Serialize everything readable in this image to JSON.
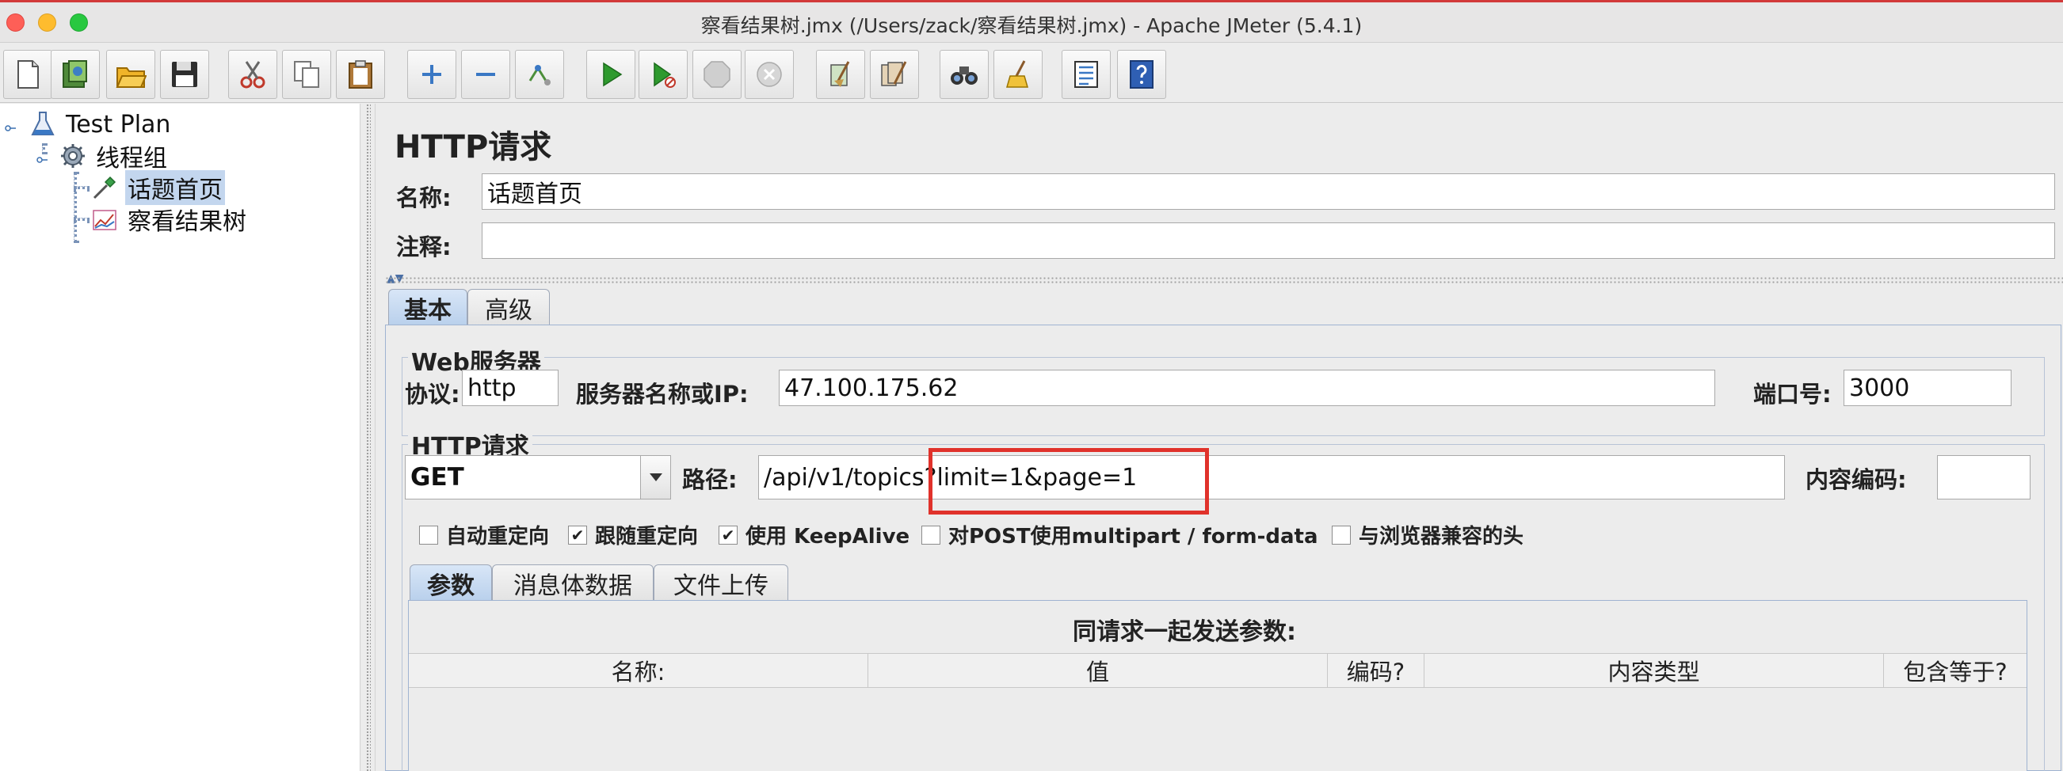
{
  "window": {
    "title": "察看结果树.jmx (/Users/zack/察看结果树.jmx) - Apache JMeter (5.4.1)"
  },
  "toolbar": {
    "buttons": [
      "new-icon",
      "templates-icon",
      "open-icon",
      "save-icon",
      "cut-icon",
      "copy-icon",
      "paste-icon",
      "expand-icon",
      "collapse-icon",
      "toggle-icon",
      "start-icon",
      "start-no-pause-icon",
      "stop-icon",
      "shutdown-icon",
      "clear-icon",
      "clear-all-icon",
      "search-icon",
      "reset-search-icon",
      "function-helper-icon",
      "help-icon"
    ]
  },
  "tree": {
    "items": [
      {
        "label": "Test Plan",
        "icon": "flask-icon"
      },
      {
        "label": "线程组",
        "icon": "gear-icon"
      },
      {
        "label": "话题首页",
        "icon": "pipette-icon",
        "selected": true
      },
      {
        "label": "察看结果树",
        "icon": "chart-icon"
      }
    ]
  },
  "panel": {
    "title": "HTTP请求",
    "name_label": "名称:",
    "name_value": "话题首页",
    "comment_label": "注释:",
    "comment_value": "",
    "tabs": [
      "基本",
      "高级"
    ],
    "web_server": {
      "group_title": "Web服务器",
      "protocol_label": "协议:",
      "protocol_value": "http",
      "server_label": "服务器名称或IP:",
      "server_value": "47.100.175.62",
      "port_label": "端口号:",
      "port_value": "3000"
    },
    "http_request": {
      "group_title": "HTTP请求",
      "method": "GET",
      "path_label": "路径:",
      "path_value": "/api/v1/topics?limit=1&page=1",
      "encoding_label": "内容编码:",
      "encoding_value": ""
    },
    "checkboxes": [
      {
        "label": "自动重定向",
        "checked": false
      },
      {
        "label": "跟随重定向",
        "checked": true
      },
      {
        "label": "使用 KeepAlive",
        "checked": true
      },
      {
        "label": "对POST使用multipart / form-data",
        "checked": false
      },
      {
        "label": "与浏览器兼容的头",
        "checked": false
      }
    ],
    "sub_tabs": [
      "参数",
      "消息体数据",
      "文件上传"
    ],
    "params_title": "同请求一起发送参数:",
    "table_headers": [
      "名称:",
      "值",
      "编码?",
      "内容类型",
      "包含等于?"
    ]
  },
  "colors": {
    "highlight": "#e0322b",
    "selection": "#c3d6ee"
  }
}
